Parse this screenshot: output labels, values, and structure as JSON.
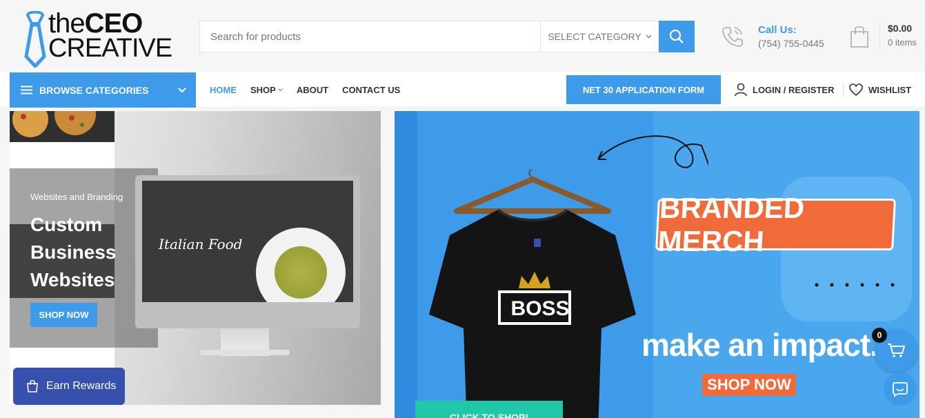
{
  "header": {
    "logo": {
      "line1_thin": "the",
      "line1_bold": "CEO",
      "line2": "CREATIVE"
    },
    "search": {
      "placeholder": "Search for products",
      "category_label": "SELECT CATEGORY"
    },
    "call": {
      "label": "Call Us:",
      "phone": "(754) 755-0445"
    },
    "cart": {
      "amount": "$0.00",
      "items": "0 items"
    }
  },
  "nav": {
    "browse_label": "BROWSE CATEGORIES",
    "menu": [
      {
        "label": "HOME",
        "active": true
      },
      {
        "label": "SHOP",
        "dropdown": true
      },
      {
        "label": "ABOUT"
      },
      {
        "label": "CONTACT US"
      }
    ],
    "net30_label": "NET 30 APPLICATION FORM",
    "login_label": "LOGIN / REGISTER",
    "wishlist_label": "WISHLIST"
  },
  "banner_left": {
    "subtitle": "Websites and Branding",
    "title": "Custom Business Websites",
    "button": "SHOP NOW",
    "mock_site_title": "Italian Food"
  },
  "banner_right": {
    "shirt_text": "BOSS",
    "headline": "BRANDED MERCH",
    "tagline": "make an impact.",
    "button": "SHOP NOW",
    "cta": "CLICK TO SHOP!"
  },
  "floating": {
    "rewards_label": "Earn Rewards",
    "cart_count": "0"
  },
  "colors": {
    "accent": "#3d9be9",
    "orange": "#f06a3a",
    "rewards": "#3550ad",
    "teal": "#1ec8a8"
  }
}
